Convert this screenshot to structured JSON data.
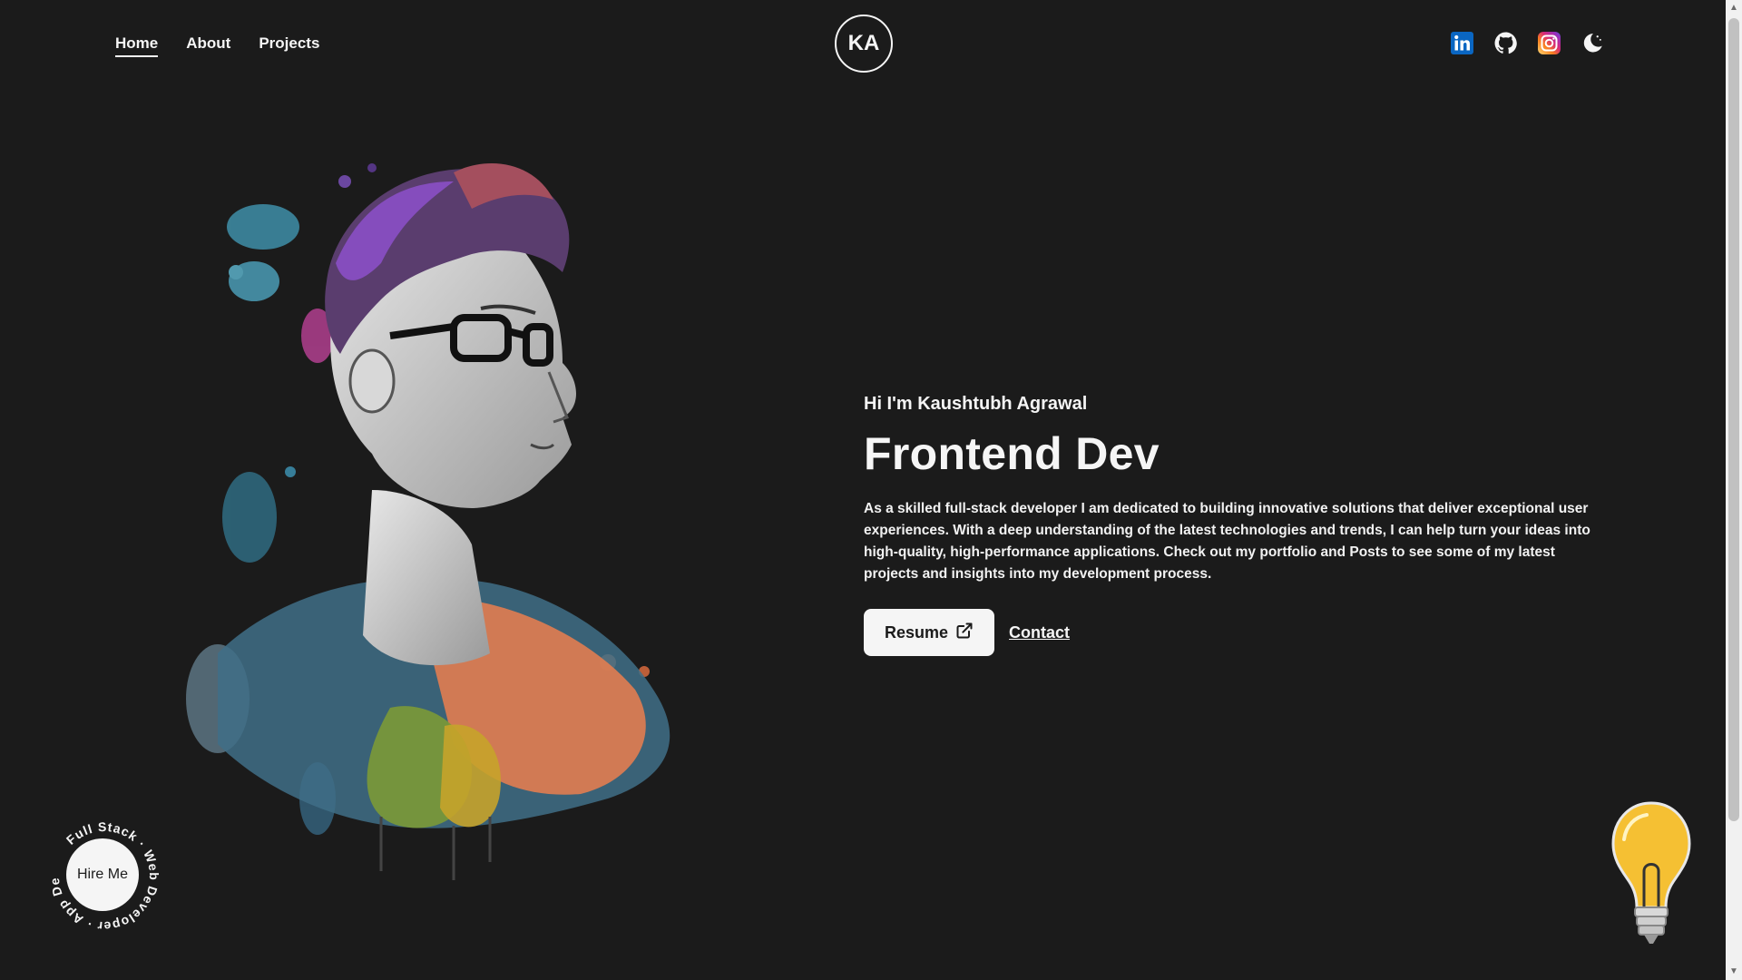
{
  "nav": {
    "items": [
      {
        "label": "Home",
        "active": true
      },
      {
        "label": "About",
        "active": false
      },
      {
        "label": "Projects",
        "active": false
      }
    ]
  },
  "logo": {
    "text": "KA"
  },
  "socials": [
    {
      "icon": "linkedin-icon"
    },
    {
      "icon": "github-icon"
    },
    {
      "icon": "instagram-icon"
    },
    {
      "icon": "moon-icon"
    }
  ],
  "hero": {
    "greeting": "Hi I'm Kaushtubh Agrawal",
    "role": "Frontend Dev",
    "description": "As a skilled full-stack developer I am dedicated to building innovative solutions that deliver exceptional user experiences. With a deep understanding of the latest technologies and trends, I can help turn your ideas into high-quality, high-performance applications. Check out my portfolio and Posts to see some of my latest projects and insights into my development process.",
    "resume_label": "Resume",
    "contact_label": "Contact"
  },
  "hire": {
    "label": "Hire Me",
    "ring_text": "Full Stack · Web Developer · App Developer ·"
  },
  "colors": {
    "background": "#1b1b1b",
    "foreground": "#f5f5f5",
    "linkedin": "#0a66c2",
    "instagram": "#e1306c",
    "bulb": "#f5c033"
  }
}
